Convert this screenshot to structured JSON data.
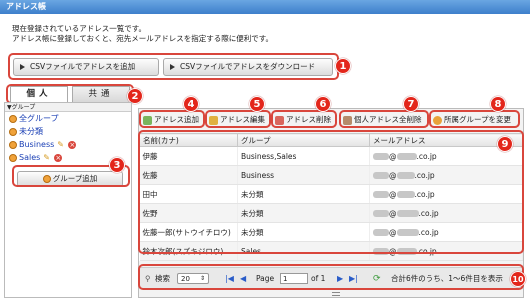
{
  "window": {
    "title": "アドレス帳"
  },
  "description": {
    "line1": "現在登録されているアドレス一覧です。",
    "line2": "アドレス帳に登録しておくと、宛先メールアドレスを指定する際に便利です。"
  },
  "top_buttons": {
    "csv_add": "CSVファイルでアドレスを追加",
    "csv_download": "CSVファイルでアドレスをダウンロード"
  },
  "tabs": [
    "個人",
    "共通"
  ],
  "groups": {
    "header": "▼グループ",
    "items": [
      "全グループ",
      "未分類",
      "Business",
      "Sales"
    ],
    "add_button": "グループ追加"
  },
  "toolbar": {
    "add": "アドレス追加",
    "edit": "アドレス編集",
    "delete": "アドレス削除",
    "delete_all": "個人アドレス全削除",
    "change_group": "所属グループを変更"
  },
  "table": {
    "columns": [
      "名前(カナ)",
      "グループ",
      "メールアドレス"
    ],
    "rows": [
      {
        "name": "伊藤",
        "group": "Business,Sales",
        "email_domain": "@",
        "email_suffix": ".co.jp"
      },
      {
        "name": "佐藤",
        "group": "Business",
        "email_domain": "@",
        "email_suffix": ".co.jp"
      },
      {
        "name": "田中",
        "group": "未分類",
        "email_domain": "@",
        "email_suffix": ".co.jp"
      },
      {
        "name": "佐野",
        "group": "未分類",
        "email_domain": "@",
        "email_suffix": ".co.jp"
      },
      {
        "name": "佐藤一郎(サトウイチロウ)",
        "group": "未分類",
        "email_domain": "@",
        "email_suffix": ".co.jp"
      },
      {
        "name": "鈴木次郎(スズキジロウ)",
        "group": "Sales",
        "email_domain": "@",
        "email_suffix": ".co.jp"
      }
    ]
  },
  "pager": {
    "search": "検索",
    "page_size": "20",
    "page_label": "Page",
    "page_value": "1",
    "of_label": "of 1",
    "summary": "合計6件のうち、1～6件目を表示"
  },
  "callouts": [
    "1",
    "2",
    "3",
    "4",
    "5",
    "6",
    "7",
    "8",
    "9",
    "10"
  ],
  "colors": {
    "callout_red": "#e3261b",
    "link_blue": "#1a3fb5",
    "title_blue": "#3d7fcb"
  }
}
